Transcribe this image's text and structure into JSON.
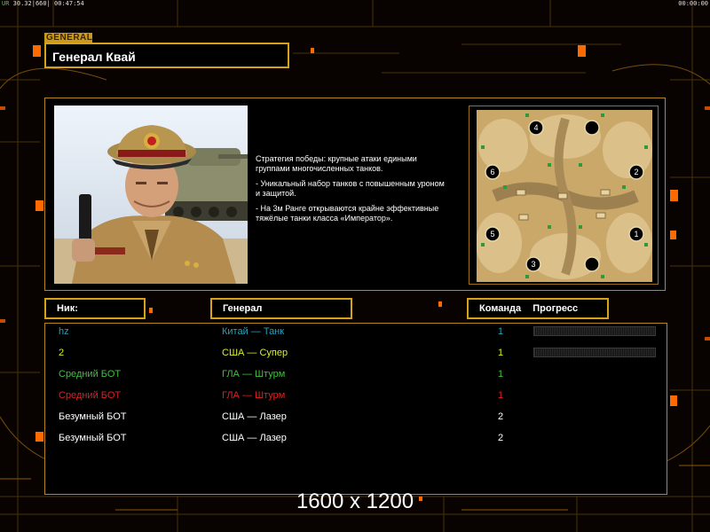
{
  "hud": {
    "left_prefix": "UR",
    "left_rest": "30.32|660| 00:47:54",
    "right": "00:00:00"
  },
  "header": {
    "tag": "GENERAL",
    "title": "Генерал Квай"
  },
  "description": [
    "Стратегия победы: крупные атаки едиными\n группами многочисленных танков.",
    "- Уникальный набор танков с повышенным уроном\n и защитой.",
    "- На 3м Ранге открываются крайне эффективные\n тяжёлые танки класса «Император»."
  ],
  "map": {
    "start_positions": [
      "1",
      "2",
      "3",
      "4",
      "5",
      "6"
    ]
  },
  "columns": {
    "nick": "Ник:",
    "general": "Генерал",
    "team": "Команда",
    "progress": "Прогресс"
  },
  "players": [
    {
      "nick": "hz",
      "general": "Китай — Танк",
      "team": "1",
      "color": "#2aa0b8",
      "has_progress": true
    },
    {
      "nick": "2",
      "general": "США — Супер",
      "team": "1",
      "color": "#d8ee30",
      "has_progress": true
    },
    {
      "nick": "Средний БОТ",
      "general": "ГЛА — Штурм",
      "team": "1",
      "color": "#40c040",
      "has_progress": false
    },
    {
      "nick": "Средний БОТ",
      "general": "ГЛА — Штурм",
      "team": "1",
      "color": "#e02020",
      "has_progress": false
    },
    {
      "nick": "Безумный БОТ",
      "general": "США — Лазер",
      "team": "2",
      "color": "#ffffff",
      "has_progress": false
    },
    {
      "nick": "Безумный БОТ",
      "general": "США — Лазер",
      "team": "2",
      "color": "#ffffff",
      "has_progress": false
    }
  ],
  "footer": {
    "resolution": "1600 x 1200"
  },
  "colors": {
    "accent": "#d6a21a",
    "panel_border": "#b8861a",
    "background": "#080300"
  }
}
